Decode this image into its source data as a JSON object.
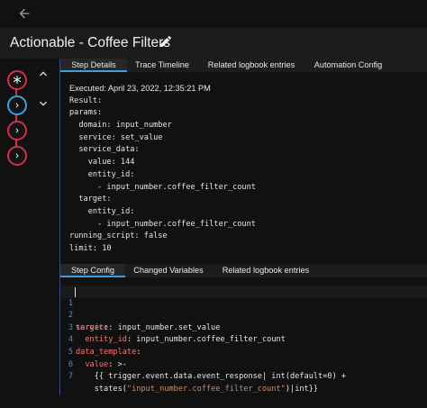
{
  "header": {
    "title": "Actionable - Coffee Filters"
  },
  "tabs_top": [
    "Step Details",
    "Trace Timeline",
    "Related logbook entries",
    "Automation Config"
  ],
  "details": {
    "executed": "Executed: April 23, 2022, 12:35:21 PM",
    "lines": [
      "Result:",
      "params:",
      "  domain: input_number",
      "  service: set_value",
      "  service_data:",
      "    value: 144",
      "    entity_id:",
      "      - input_number.coffee_filter_count",
      "  target:",
      "    entity_id:",
      "      - input_number.coffee_filter_count",
      "running_script: false",
      "limit: 10"
    ]
  },
  "tabs_bottom": [
    "Step Config",
    "Changed Variables",
    "Related logbook entries"
  ],
  "config": {
    "line_numbers": [
      "1",
      "2",
      "3",
      "4",
      "5",
      "6",
      "7"
    ],
    "l1_key": "service",
    "l1_val": " input_number.set_value",
    "l2_key": "target",
    "l3_key": "entity_id",
    "l3_val": " input_number.coffee_filter_count",
    "l4_key": "data_template",
    "l5_key": "value",
    "l5_val": " >-",
    "l6_text": "{{ trigger.event.data.event_response| int(default=0) +",
    "l7_pre": "states(",
    "l7_str": "\"input_number.coffee_filter_count\"",
    "l7_post": ")|int}}"
  },
  "colors": {
    "accent": "#3b9fe0",
    "node_border": "#d0304a",
    "yaml_key": "#f07a7a",
    "yaml_string": "#d88a5a"
  },
  "icons": [
    "arrow-left-icon",
    "pencil-icon",
    "asterisk-icon",
    "chevron-right-icon",
    "chevron-up-icon",
    "chevron-down-icon"
  ]
}
